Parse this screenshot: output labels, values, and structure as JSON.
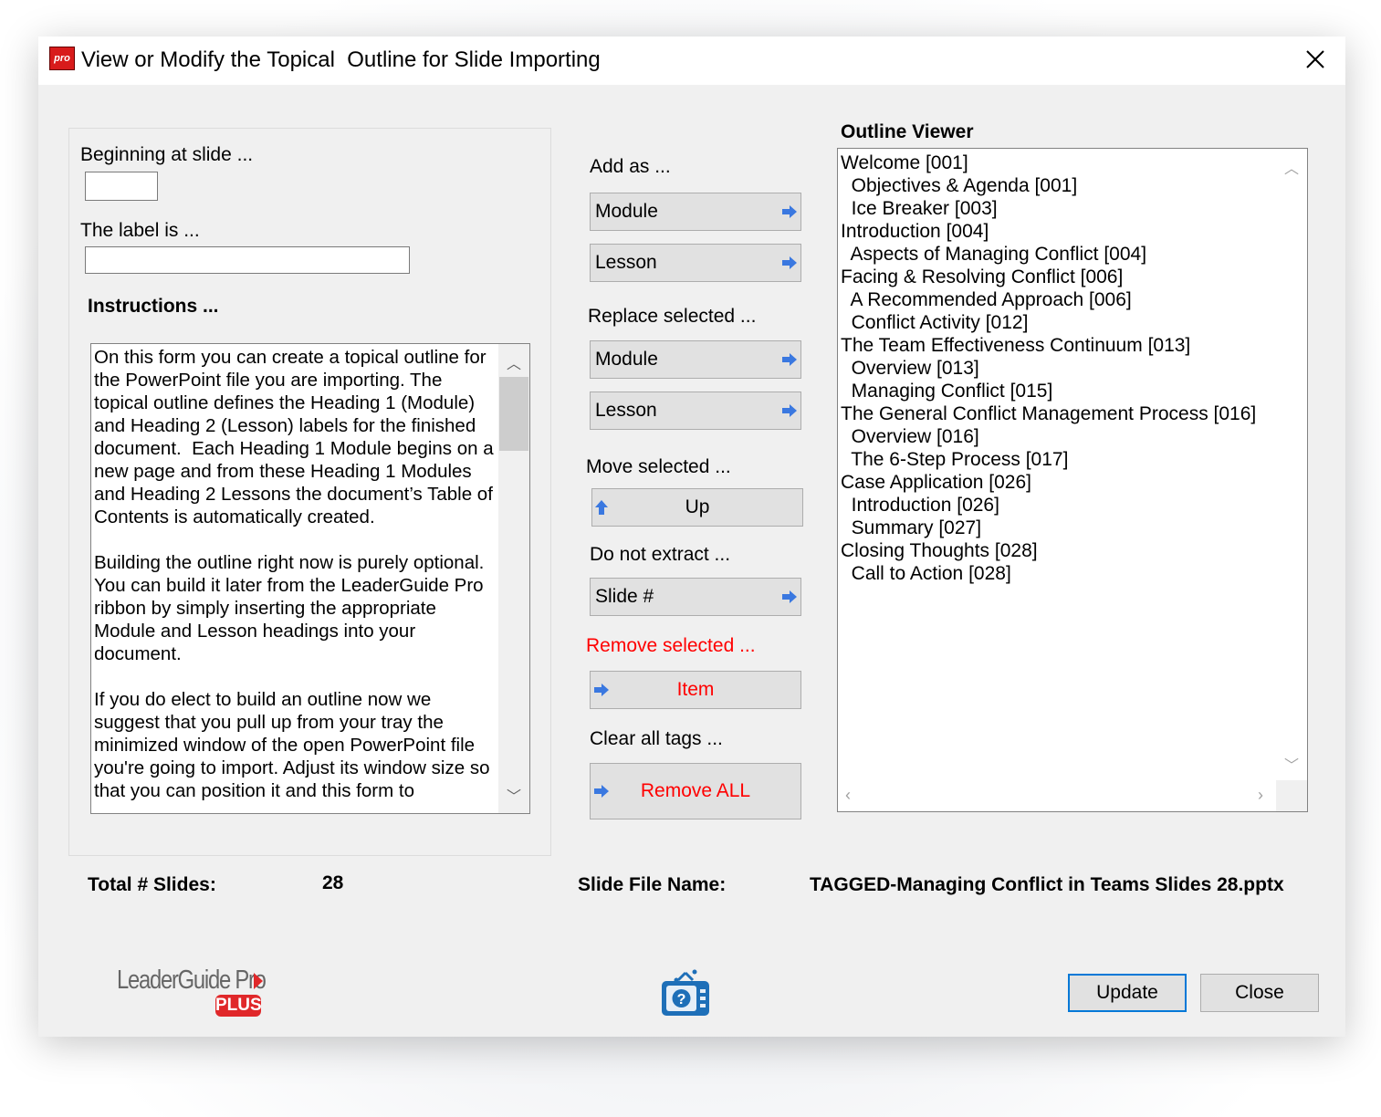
{
  "window": {
    "title": "View or Modify the Topical  Outline for Slide Importing",
    "app_icon_text": "pro",
    "close_glyph": "✕"
  },
  "left": {
    "beginning_label": "Beginning at slide ...",
    "beginning_value": "",
    "label_label": "The label is ...",
    "label_value": "",
    "instructions_heading": "Instructions ...",
    "instructions_text": "On this form you can create a topical outline for the PowerPoint file you are importing. The topical outline defines the Heading 1 (Module) and Heading 2 (Lesson) labels for the finished document.  Each Heading 1 Module begins on a new page and from these Heading 1 Modules and Heading 2 Lessons the document’s Table of Contents is automatically created.\n\nBuilding the outline right now is purely optional. You can build it later from the LeaderGuide Pro ribbon by simply inserting the appropriate Module and Lesson headings into your document.\n\nIf you do elect to build an outline now we suggest that you pull up from your tray the minimized window of the open PowerPoint file you're going to import. Adjust its window size so that you can position it and this form to"
  },
  "middle": {
    "add_as_label": "Add as ...",
    "add_module": "Module",
    "add_lesson": "Lesson",
    "replace_label": "Replace selected ...",
    "replace_module": "Module",
    "replace_lesson": "Lesson",
    "move_label": "Move selected ...",
    "move_up": "Up",
    "noextract_label": "Do not extract ...",
    "noextract_slide": "Slide #",
    "remove_label": "Remove selected ...",
    "remove_item": "Item",
    "clear_label": "Clear all tags ...",
    "remove_all": "Remove ALL"
  },
  "outline": {
    "heading": "Outline Viewer",
    "items": [
      "Welcome [001]",
      "  Objectives & Agenda [001]",
      "  Ice Breaker [003]",
      "Introduction [004]",
      "  Aspects of Managing Conflict [004]",
      "Facing & Resolving Conflict [006]",
      "  A Recommended Approach [006]",
      "  Conflict Activity [012]",
      "The Team Effectiveness Continuum [013]",
      "  Overview [013]",
      "  Managing Conflict [015]",
      "The General Conflict Management Process [016]",
      "  Overview [016]",
      "  The 6-Step Process [017]",
      "Case Application [026]",
      "  Introduction [026]",
      "  Summary [027]",
      "Closing Thoughts [028]",
      "  Call to Action [028]"
    ]
  },
  "footer": {
    "total_label": "Total # Slides:",
    "total_value": "28",
    "file_label": "Slide File Name:",
    "file_value": "TAGGED-Managing Conflict in Teams Slides 28.pptx",
    "logo_text": "LeaderGuide Pro",
    "logo_plus": "PLUS",
    "update": "Update",
    "close": "Close"
  },
  "colors": {
    "red": "#ff0000",
    "arrow_blue": "#3a78e0",
    "accent": "#0078d7"
  }
}
